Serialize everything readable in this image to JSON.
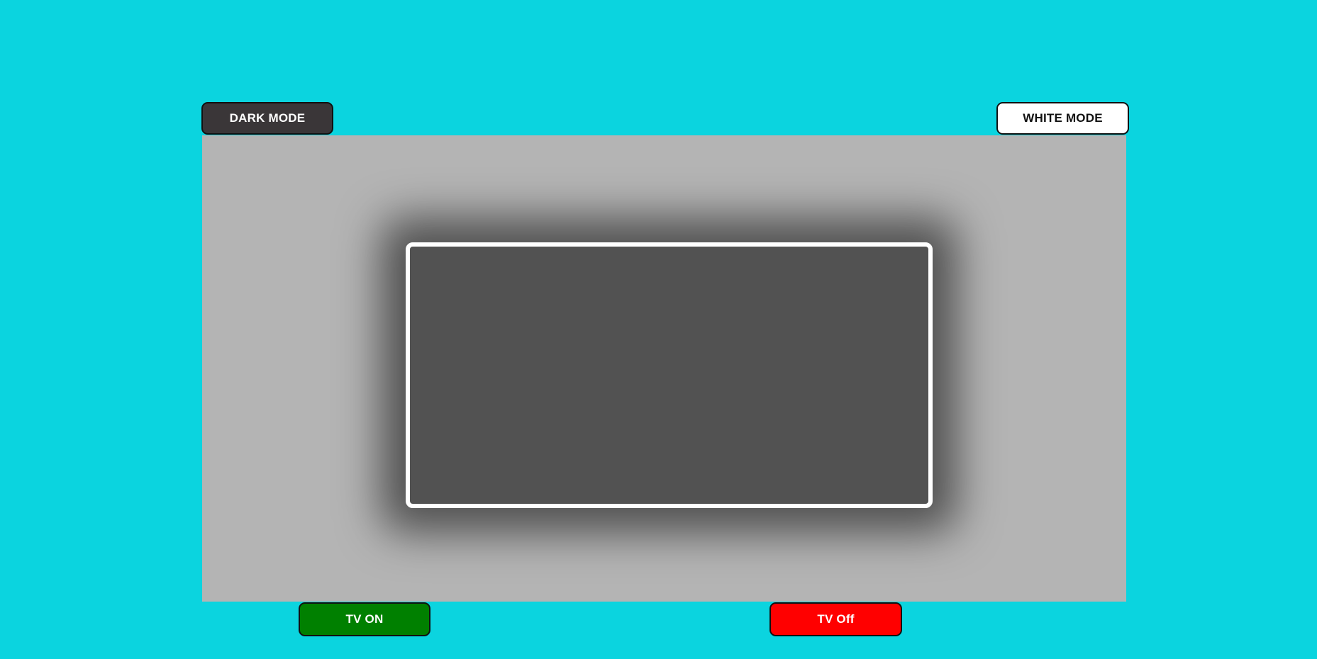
{
  "theme_controls": {
    "dark_mode_label": "DARK MODE",
    "white_mode_label": "WHITE MODE"
  },
  "tv": {
    "power_on_label": "TV ON",
    "power_off_label": "TV Off"
  },
  "colors": {
    "page_background": "#0bd4df",
    "stage_background": "#b4b4b4",
    "screen_fill": "#525252",
    "screen_border": "#ffffff",
    "dark_button": "#3a3638",
    "white_button": "#ffffff",
    "tv_on_button": "#008000",
    "tv_off_button": "#ff0000"
  }
}
